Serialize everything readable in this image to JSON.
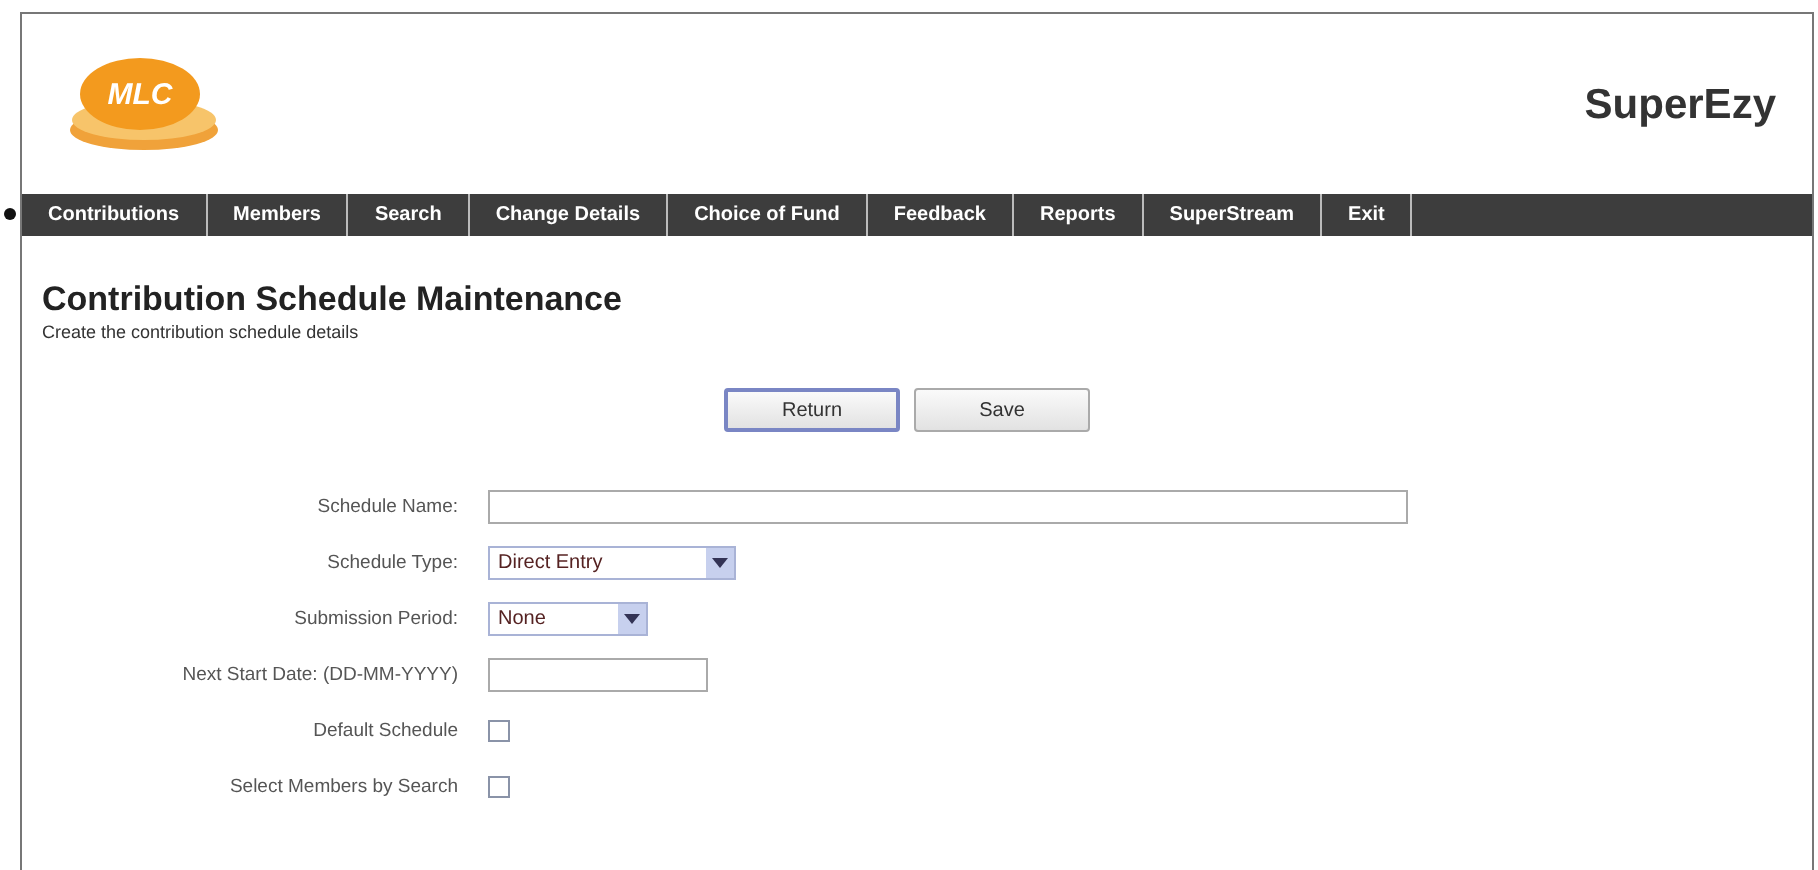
{
  "brand": {
    "logo_text": "MLC",
    "product": "SuperEzy"
  },
  "nav": [
    {
      "label": "Contributions"
    },
    {
      "label": "Members"
    },
    {
      "label": "Search"
    },
    {
      "label": "Change Details"
    },
    {
      "label": "Choice of Fund"
    },
    {
      "label": "Feedback"
    },
    {
      "label": "Reports"
    },
    {
      "label": "SuperStream"
    },
    {
      "label": "Exit"
    }
  ],
  "page": {
    "title": "Contribution Schedule Maintenance",
    "subtitle": "Create the contribution schedule details"
  },
  "buttons": [
    {
      "label": "Return",
      "selected": true
    },
    {
      "label": "Save",
      "selected": false
    }
  ],
  "form": [
    {
      "kind": "text",
      "label": "Schedule Name:"
    },
    {
      "kind": "select",
      "label": "Schedule Type:",
      "value": "Direct Entry"
    },
    {
      "kind": "select",
      "label": "Submission Period:",
      "value": "None"
    },
    {
      "kind": "text",
      "label": "Next Start Date: (DD-MM-YYYY)"
    },
    {
      "kind": "checkbox",
      "label": "Default Schedule",
      "checked": false
    },
    {
      "kind": "checkbox",
      "label": "Select Members by Search",
      "checked": false
    }
  ]
}
